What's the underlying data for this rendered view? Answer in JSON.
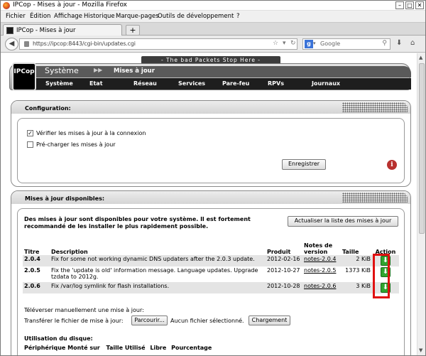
{
  "window": {
    "title": "IPCop - Mises à jour - Mozilla Firefox"
  },
  "menubar": [
    "Fichier",
    "Édition",
    "Affichage",
    "Historique",
    "Marque-pages",
    "Outils de développement",
    "?"
  ],
  "tab": {
    "label": "IPCop - Mises à jour",
    "new_tab": "+"
  },
  "nav": {
    "url": "https://ipcop:8443/cgi-bin/updates.cgi",
    "search_placeholder": "Google"
  },
  "header": {
    "slogan": "- The bad Packets Stop Here -",
    "logo": "IPCop",
    "section": "Système",
    "arrow": "▶▶",
    "subsection": "Mises à jour",
    "menu": [
      "Système",
      "Etat",
      "Réseau",
      "Services",
      "Pare-feu",
      "RPVs",
      "Journaux"
    ]
  },
  "config": {
    "title": "Configuration:",
    "check_connect_label": "Vérifier les mises à jour à la connexion",
    "check_connect_checked": true,
    "preload_label": "Pré-charger les mises à jour",
    "preload_checked": false,
    "save_button": "Enregistrer",
    "info_icon": "i"
  },
  "updates": {
    "title": "Mises à jour disponibles:",
    "message": "Des mises à jour sont disponibles pour votre système. Il est fortement recommandé de les installer le plus rapidement possible.",
    "refresh_button": "Actualiser la liste des mises à jour",
    "columns": {
      "title": "Titre",
      "description": "Description",
      "product": "Produit",
      "notes_line1": "Notes de",
      "notes_line2": "version",
      "size": "Taille",
      "action": "Action"
    },
    "rows": [
      {
        "title": "2.0.4",
        "description": "Fix for some not working dynamic DNS updaters after the 2.0.3 update.",
        "product": "2012-02-16",
        "notes": "notes-2.0.4",
        "size": "2 KiB"
      },
      {
        "title": "2.0.5",
        "description": "Fix the 'update is old' information message. Language updates. Upgrade tzdata to 2012g.",
        "product": "2012-10-27",
        "notes": "notes-2.0.5",
        "size": "1373 KiB"
      },
      {
        "title": "2.0.6",
        "description": "Fix /var/log symlink for flash installations.",
        "product": "2012-10-28",
        "notes": "notes-2.0.6",
        "size": "3 KiB"
      }
    ],
    "upload_title": "Téléverser manuellement une mise à jour:",
    "upload_label": "Transférer le fichier de mise à jour:",
    "browse_button": "Parcourir...",
    "no_file": "Aucun fichier sélectionné.",
    "upload_button": "Chargement",
    "disk_title": "Utilisation du disque:",
    "disk_columns": [
      "Périphérique",
      "Monté sur",
      "Taille",
      "Utilisé",
      "Libre",
      "Pourcentage"
    ]
  }
}
